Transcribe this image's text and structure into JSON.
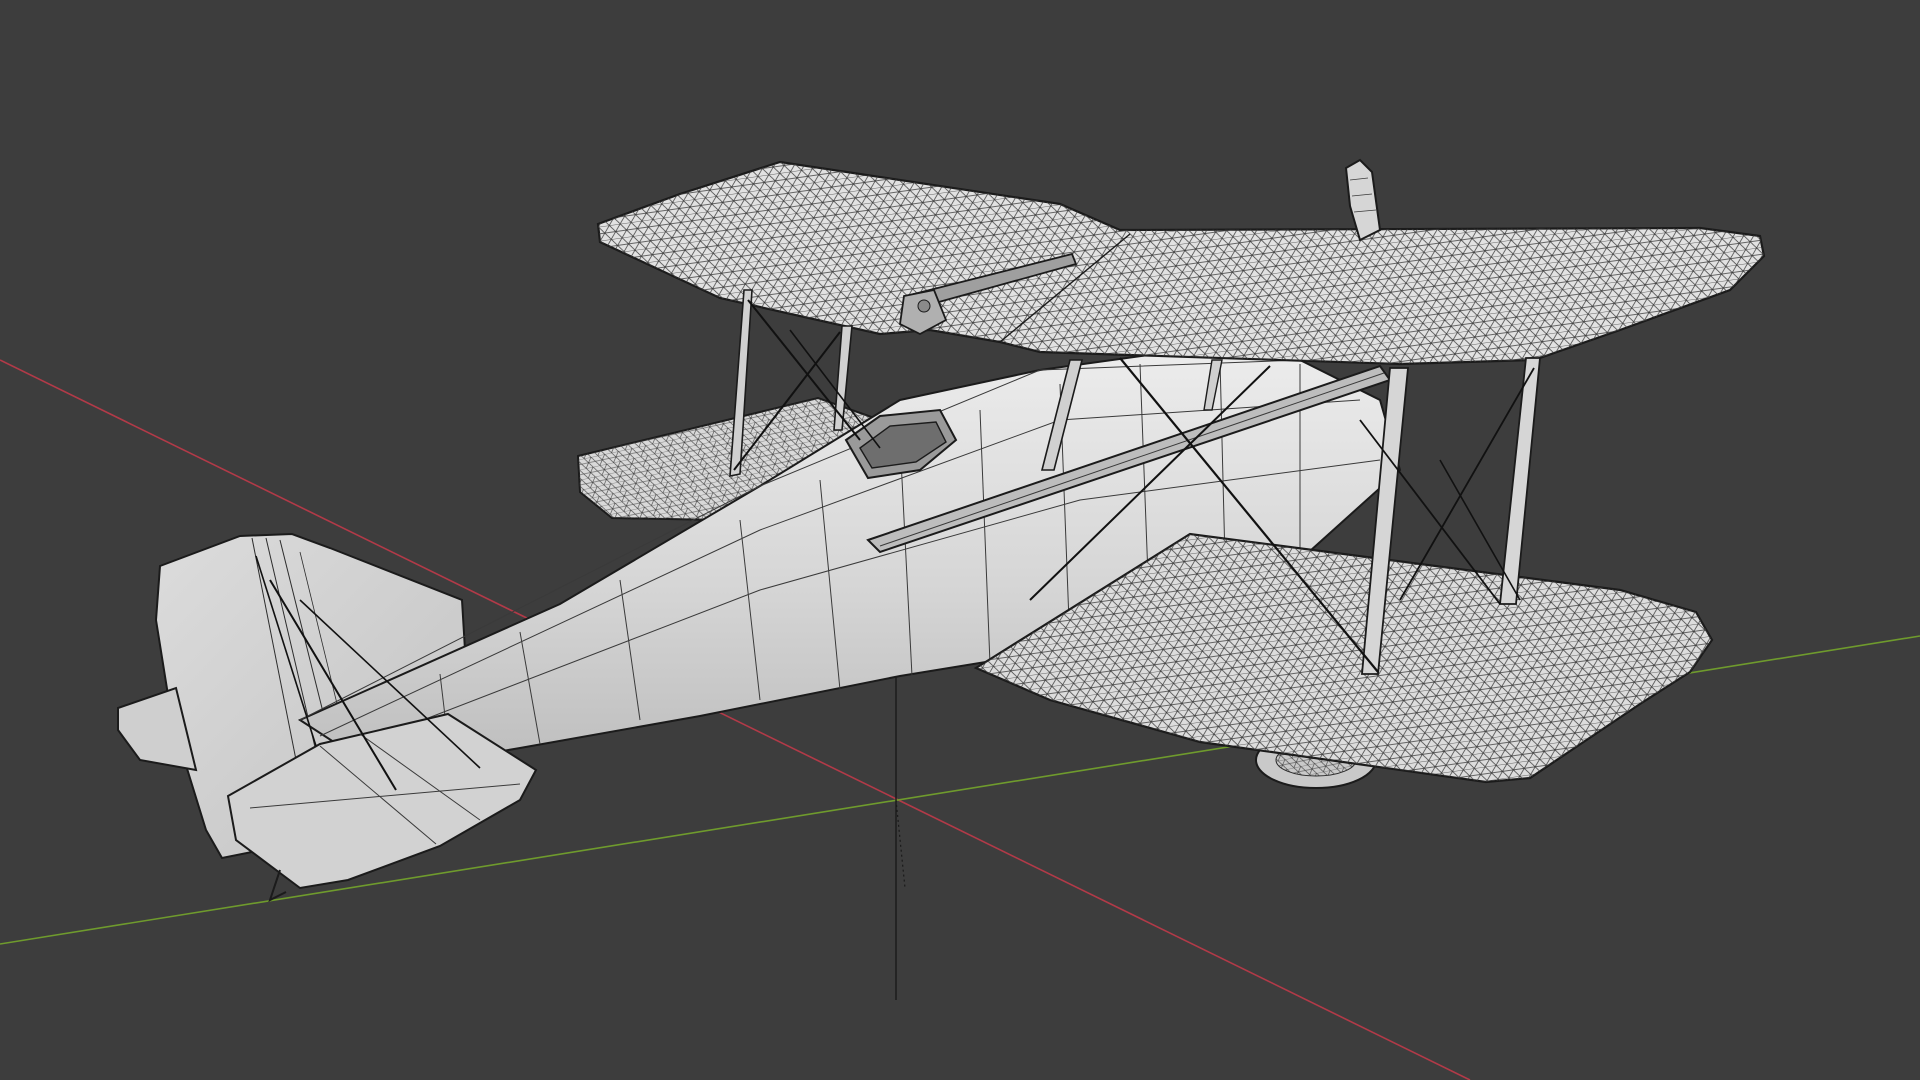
{
  "viewport": {
    "mode": "3d-viewport",
    "shading": "solid-with-wireframe-overlay",
    "object": "biplane",
    "colors": {
      "background": "#3d3d3d",
      "x_axis": "#b23a48",
      "y_axis": "#6f9b2d",
      "z_axis": "#1a1a1a",
      "mesh_fill": "#d4d4d4",
      "mesh_fill_light": "#e6e6e6",
      "mesh_fill_shadow": "#b9b9b9",
      "wire": "#2a2a2a",
      "brace_wire": "#111111"
    }
  }
}
